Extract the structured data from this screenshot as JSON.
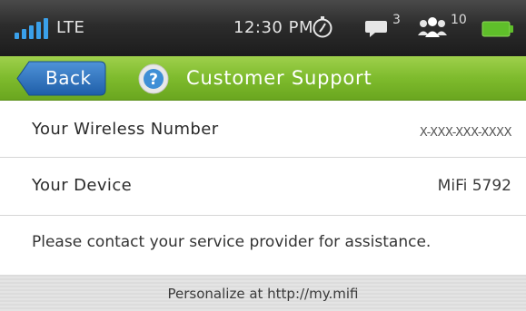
{
  "status_bar": {
    "network": "LTE",
    "time": "12:30 PM",
    "messages_count": "3",
    "users_count": "10",
    "signal_icon": "signal-bars-icon",
    "stopwatch_icon": "stopwatch-icon",
    "message_icon": "message-icon",
    "users_icon": "users-icon",
    "battery_icon": "battery-icon"
  },
  "header": {
    "back_label": "Back",
    "title": "Customer Support",
    "help_icon": "help-icon",
    "accent_color": "#7ebb2d"
  },
  "rows": [
    {
      "label": "Your Wireless Number",
      "value": "X-XXX-XXX-XXXX"
    },
    {
      "label": "Your Device",
      "value": "MiFi 5792"
    }
  ],
  "notice": "Please contact your service provider for assistance.",
  "footer": {
    "text": "Personalize at http://my.mifi"
  }
}
